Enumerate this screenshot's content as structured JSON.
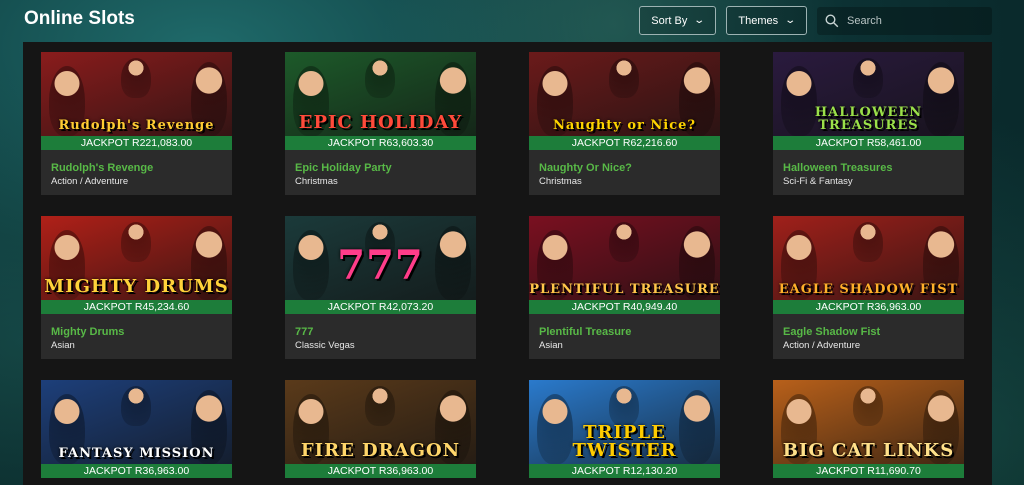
{
  "header": {
    "title": "Online Slots",
    "sort_label": "Sort By",
    "themes_label": "Themes",
    "search_placeholder": "Search"
  },
  "games": [
    {
      "name": "Rudolph's Revenge",
      "category": "Action / Adventure",
      "jackpot": "JACKPOT R221,083.00",
      "art_text": "Rudolph's Revenge",
      "bg": "#8a1c1c",
      "accent": "#ffcc33"
    },
    {
      "name": "Epic Holiday Party",
      "category": "Christmas",
      "jackpot": "JACKPOT R63,603.30",
      "art_text": "EPIC HOLIDAY",
      "bg": "#1d5a2a",
      "accent": "#ff4a3a"
    },
    {
      "name": "Naughty Or Nice?",
      "category": "Christmas",
      "jackpot": "JACKPOT R62,216.60",
      "art_text": "Naughty or Nice?",
      "bg": "#6b1a1a",
      "accent": "#ffd400"
    },
    {
      "name": "Halloween Treasures",
      "category": "Sci-Fi & Fantasy",
      "jackpot": "JACKPOT R58,461.00",
      "art_text": "HALLOWEEN TREASURES",
      "bg": "#2a1a3e",
      "accent": "#9be04a"
    },
    {
      "name": "Mighty Drums",
      "category": "Asian",
      "jackpot": "JACKPOT R45,234.60",
      "art_text": "MIGHTY DRUMS",
      "bg": "#b02018",
      "accent": "#ffd23a"
    },
    {
      "name": "777",
      "category": "Classic Vegas",
      "jackpot": "JACKPOT R42,073.20",
      "art_text": "777",
      "bg": "#1b3a3a",
      "accent": "#ff3d8a"
    },
    {
      "name": "Plentiful Treasure",
      "category": "Asian",
      "jackpot": "JACKPOT R40,949.40",
      "art_text": "PLENTIFUL TREASURE",
      "bg": "#7a1020",
      "accent": "#ffc64a"
    },
    {
      "name": "Eagle Shadow Fist",
      "category": "Action / Adventure",
      "jackpot": "JACKPOT R36,963.00",
      "art_text": "EAGLE SHADOW FIST",
      "bg": "#a0201a",
      "accent": "#ffb02a"
    },
    {
      "name": "Fantasy Mission",
      "category": "",
      "jackpot": "JACKPOT R36,963.00",
      "art_text": "FANTASY MISSION",
      "bg": "#1d3f7a",
      "accent": "#ffffff"
    },
    {
      "name": "Fire Dragon",
      "category": "",
      "jackpot": "JACKPOT R36,963.00",
      "art_text": "FIRE DRAGON",
      "bg": "#5a3a1a",
      "accent": "#ffd66a"
    },
    {
      "name": "Triple Twister",
      "category": "",
      "jackpot": "JACKPOT R12,130.20",
      "art_text": "TRIPLE TWISTER",
      "bg": "#2a7acc",
      "accent": "#ffcc00"
    },
    {
      "name": "Big Cat Links",
      "category": "",
      "jackpot": "JACKPOT R11,690.70",
      "art_text": "BIG CAT LINKS",
      "bg": "#b8601a",
      "accent": "#ffe08a"
    }
  ],
  "colors": {
    "jackpot_bar": "#1d7d3a",
    "game_name": "#58b947",
    "card_bg": "#2b2b2b"
  }
}
